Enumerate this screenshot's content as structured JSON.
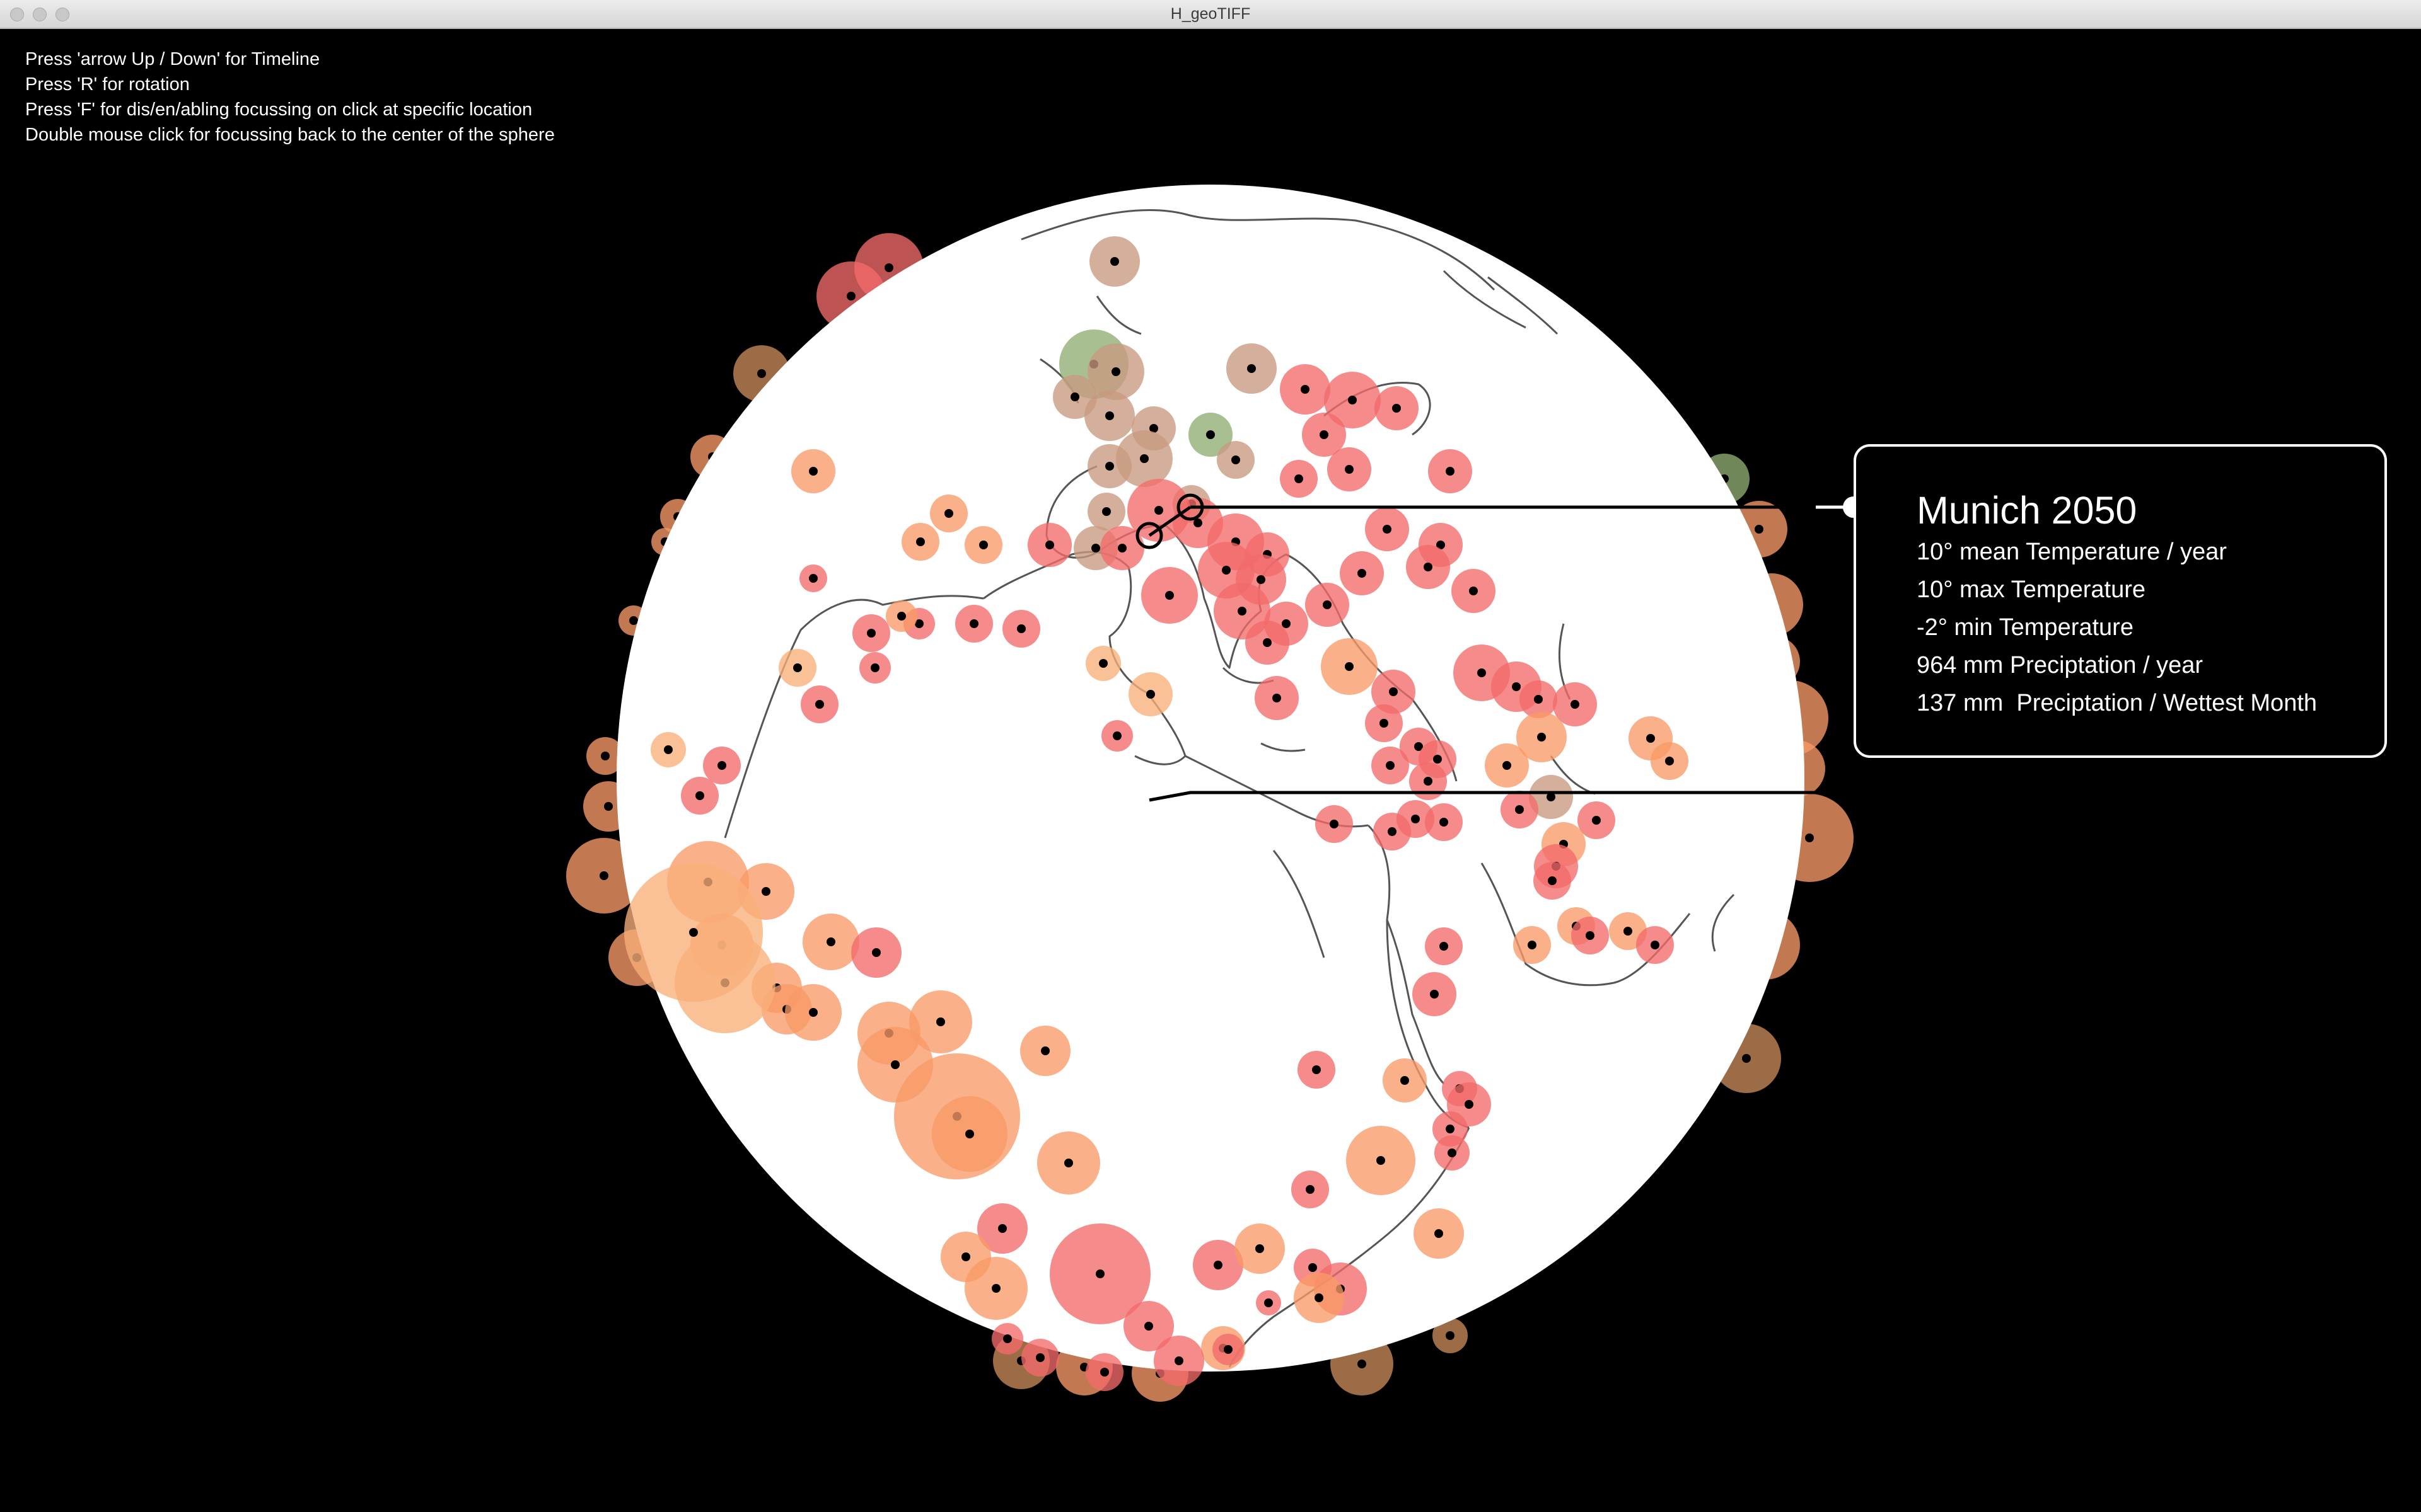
{
  "window": {
    "title": "H_geoTIFF"
  },
  "instructions": [
    "Press 'arrow Up / Down' for Timeline",
    "Press 'R' for rotation",
    "Press 'F' for dis/en/abling focussing on click at specific location",
    "Double mouse click for focussing back to the center of the sphere"
  ],
  "popup": {
    "title": "Munich 2050",
    "lines": [
      "10° mean Temperature / year",
      "10° max Temperature",
      "-2° min Temperature",
      "964 mm Preciptation / year",
      "137 mm  Preciptation / Wettest Month"
    ]
  },
  "colors": {
    "background": "#000000",
    "sphere": "#ffffff",
    "coastline": "#555555",
    "popup_border": "#ffffff",
    "marker_red": "#f26a6a",
    "marker_orange": "#f89a66",
    "marker_light_orange": "#f8b07a",
    "marker_brown": "#c88a5a",
    "marker_green": "#8fae72",
    "marker_tan": "#c89a80"
  }
}
